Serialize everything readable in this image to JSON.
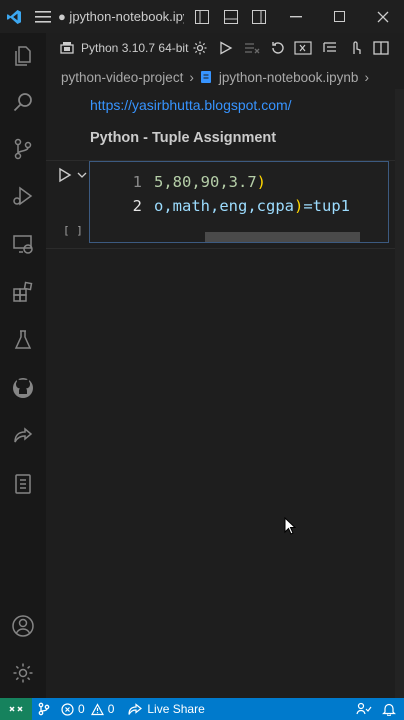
{
  "titlebar": {
    "title": "● jpython-notebook.ipynb - python-video-project - Visual Studio Code"
  },
  "activity_bar": {
    "items": [
      "explorer-icon",
      "search-icon",
      "source-control-icon",
      "run-debug-icon",
      "remote-explorer-icon",
      "extensions-icon",
      "testing-icon",
      "github-icon",
      "live-share-icon",
      "notebook-icon"
    ],
    "bottom": [
      "account-icon",
      "settings-gear-icon"
    ]
  },
  "toolbar": {
    "kernel_label": "Python 3.10.7 64-bit"
  },
  "breadcrumb": {
    "folder": "python-video-project",
    "file": "jpython-notebook.ipynb"
  },
  "markdown": {
    "link": "https://yasirbhutta.blogspot.com/",
    "heading": "Python - Tuple Assignment"
  },
  "cell": {
    "exec_count": "[ ]",
    "lines": [
      {
        "number": "1",
        "parts": [
          {
            "t": "5,80,90,3.7",
            "c": "num"
          },
          {
            "t": ")",
            "c": "paren"
          }
        ]
      },
      {
        "number": "2",
        "parts": [
          {
            "t": "o,math,eng,cgpa",
            "c": "var"
          },
          {
            "t": ")",
            "c": "paren"
          },
          {
            "t": "=tup1",
            "c": "var"
          }
        ]
      }
    ]
  },
  "statusbar": {
    "errors": "0",
    "warnings": "0",
    "live_share": "Live Share"
  },
  "colors": {
    "accent": "#007acc",
    "remote": "#16825d",
    "link": "#3794ff"
  }
}
